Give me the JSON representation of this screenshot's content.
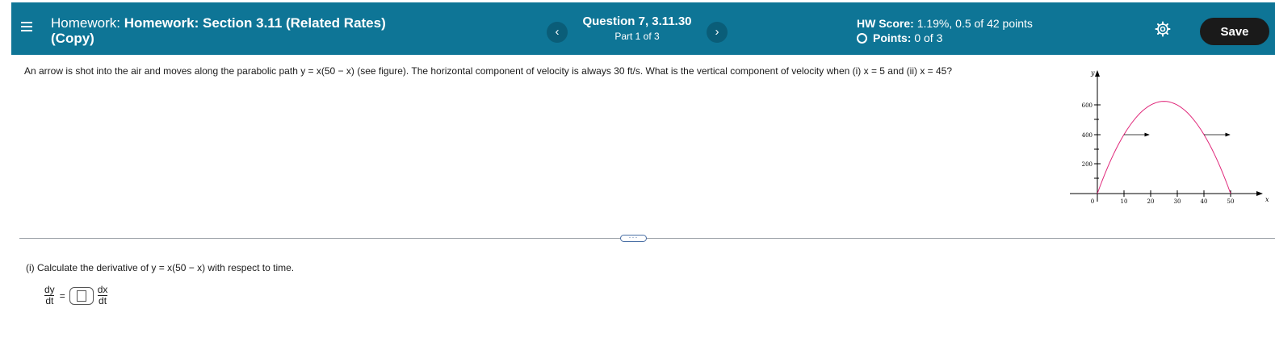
{
  "header": {
    "title_prefix": "Homework:",
    "title_main": "Homework: Section 3.11 (Related Rates)",
    "title_suffix": "(Copy)",
    "prev_symbol": "‹",
    "next_symbol": "›",
    "question_title": "Question 7, 3.11.30",
    "question_part": "Part 1 of 3",
    "hw_score_label": "HW Score:",
    "hw_score_value": "1.19%, 0.5 of 42 points",
    "points_label": "Points:",
    "points_value": "0 of 3",
    "save_label": "Save",
    "colors": {
      "bar": "#0e7596",
      "save_bg": "#1a1a1a"
    }
  },
  "question": {
    "text": "An arrow is shot into the air and moves along the parabolic path y = x(50 − x) (see figure). The horizontal component of velocity is always 30 ft/s. What is the vertical component of velocity when (i) x = 5 and (ii) x = 45?"
  },
  "figure": {
    "y_axis_label": "y",
    "x_axis_label": "x",
    "y_ticks": [
      "600",
      "400",
      "200"
    ],
    "x_ticks": [
      "10",
      "20",
      "30",
      "40",
      "50"
    ],
    "origin_label": "0",
    "curve_color": "#e0287a"
  },
  "splitter": {
    "label": "···"
  },
  "part": {
    "prompt": "(i) Calculate the derivative of y = x(50 − x) with respect to time.",
    "lhs_num": "dy",
    "lhs_den": "dt",
    "equals": "=",
    "rhs_num": "dx",
    "rhs_den": "dt"
  }
}
